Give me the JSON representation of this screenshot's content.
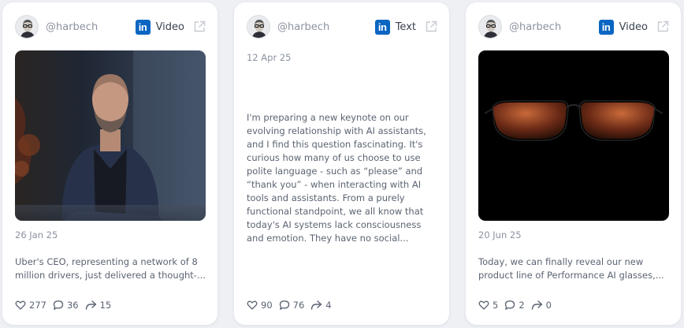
{
  "posts": [
    {
      "handle": "@harbech",
      "network_icon": "linkedin-icon",
      "type": "Video",
      "date": "26 Jan 25",
      "text_lines": [
        "Uber's CEO, representing a network of 8",
        "million drivers, just delivered a thought-..."
      ],
      "likes": "277",
      "comments": "36",
      "shares": "15",
      "media": "video-thumbnail-man-in-blue-jacket"
    },
    {
      "handle": "@harbech",
      "network_icon": "linkedin-icon",
      "type": "Text",
      "date": "12 Apr 25",
      "text_lines": [
        "I'm preparing a new keynote on our",
        "evolving relationship with AI assistants,",
        "and I find this question fascinating. It's",
        "curious how many of us choose to use",
        "polite language - such as “please” and",
        "“thank you” - when interacting with AI",
        "tools and assistants. From a purely",
        "functional standpoint, we all know that",
        "today's AI systems lack consciousness",
        "and emotion. They have no social..."
      ],
      "likes": "90",
      "comments": "76",
      "shares": "4"
    },
    {
      "handle": "@harbech",
      "network_icon": "linkedin-icon",
      "type": "Video",
      "date": "20 Jun 25",
      "text_lines": [
        "Today, we can finally reveal our new",
        "product line of Performance AI glasses,..."
      ],
      "likes": "5",
      "comments": "2",
      "shares": "0",
      "media": "video-thumbnail-sunglasses-on-black"
    }
  ],
  "colors": {
    "linkedin_blue": "#0a66c2",
    "muted_text": "#8b93a1",
    "body_text": "#5b6472",
    "background": "#eef0f4"
  }
}
